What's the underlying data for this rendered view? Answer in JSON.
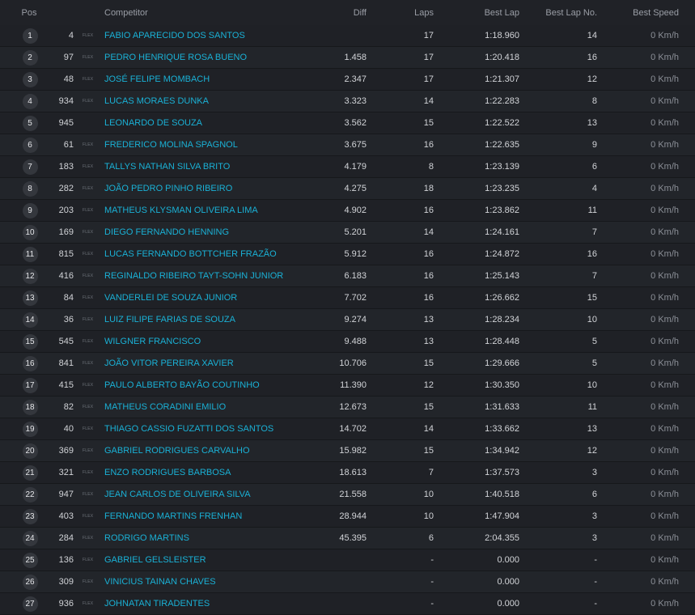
{
  "headers": {
    "pos": "Pos",
    "competitor": "Competitor",
    "diff": "Diff",
    "laps": "Laps",
    "best_lap": "Best Lap",
    "best_lap_no": "Best Lap No.",
    "best_speed": "Best Speed"
  },
  "rows": [
    {
      "pos": "1",
      "number": "4",
      "class": "FLEX",
      "name": "FABIO APARECIDO DOS SANTOS",
      "diff": "",
      "laps": "17",
      "best_lap": "1:18.960",
      "best_lap_no": "14",
      "best_speed": "0 Km/h"
    },
    {
      "pos": "2",
      "number": "97",
      "class": "FLEX",
      "name": "PEDRO HENRIQUE ROSA BUENO",
      "diff": "1.458",
      "laps": "17",
      "best_lap": "1:20.418",
      "best_lap_no": "16",
      "best_speed": "0 Km/h"
    },
    {
      "pos": "3",
      "number": "48",
      "class": "FLEX",
      "name": "JOSÉ FELIPE MOMBACH",
      "diff": "2.347",
      "laps": "17",
      "best_lap": "1:21.307",
      "best_lap_no": "12",
      "best_speed": "0 Km/h"
    },
    {
      "pos": "4",
      "number": "934",
      "class": "FLEX",
      "name": "LUCAS MORAES DUNKA",
      "diff": "3.323",
      "laps": "14",
      "best_lap": "1:22.283",
      "best_lap_no": "8",
      "best_speed": "0 Km/h"
    },
    {
      "pos": "5",
      "number": "945",
      "class": "",
      "name": "LEONARDO DE SOUZA",
      "diff": "3.562",
      "laps": "15",
      "best_lap": "1:22.522",
      "best_lap_no": "13",
      "best_speed": "0 Km/h"
    },
    {
      "pos": "6",
      "number": "61",
      "class": "FLEX",
      "name": "FREDERICO MOLINA SPAGNOL",
      "diff": "3.675",
      "laps": "16",
      "best_lap": "1:22.635",
      "best_lap_no": "9",
      "best_speed": "0 Km/h"
    },
    {
      "pos": "7",
      "number": "183",
      "class": "FLEX",
      "name": "TALLYS NATHAN SILVA BRITO",
      "diff": "4.179",
      "laps": "8",
      "best_lap": "1:23.139",
      "best_lap_no": "6",
      "best_speed": "0 Km/h"
    },
    {
      "pos": "8",
      "number": "282",
      "class": "FLEX",
      "name": "JOÃO PEDRO PINHO RIBEIRO",
      "diff": "4.275",
      "laps": "18",
      "best_lap": "1:23.235",
      "best_lap_no": "4",
      "best_speed": "0 Km/h"
    },
    {
      "pos": "9",
      "number": "203",
      "class": "FLEX",
      "name": "MATHEUS KLYSMAN OLIVEIRA LIMA",
      "diff": "4.902",
      "laps": "16",
      "best_lap": "1:23.862",
      "best_lap_no": "11",
      "best_speed": "0 Km/h"
    },
    {
      "pos": "10",
      "number": "169",
      "class": "FLEX",
      "name": "DIEGO FERNANDO HENNING",
      "diff": "5.201",
      "laps": "14",
      "best_lap": "1:24.161",
      "best_lap_no": "7",
      "best_speed": "0 Km/h"
    },
    {
      "pos": "11",
      "number": "815",
      "class": "FLEX",
      "name": "LUCAS FERNANDO BOTTCHER FRAZÃO",
      "diff": "5.912",
      "laps": "16",
      "best_lap": "1:24.872",
      "best_lap_no": "16",
      "best_speed": "0 Km/h"
    },
    {
      "pos": "12",
      "number": "416",
      "class": "FLEX",
      "name": "REGINALDO RIBEIRO TAYT-SOHN JUNIOR",
      "diff": "6.183",
      "laps": "16",
      "best_lap": "1:25.143",
      "best_lap_no": "7",
      "best_speed": "0 Km/h"
    },
    {
      "pos": "13",
      "number": "84",
      "class": "FLEX",
      "name": "VANDERLEI DE SOUZA JUNIOR",
      "diff": "7.702",
      "laps": "16",
      "best_lap": "1:26.662",
      "best_lap_no": "15",
      "best_speed": "0 Km/h"
    },
    {
      "pos": "14",
      "number": "36",
      "class": "FLEX",
      "name": "LUIZ FILIPE FARIAS DE SOUZA",
      "diff": "9.274",
      "laps": "13",
      "best_lap": "1:28.234",
      "best_lap_no": "10",
      "best_speed": "0 Km/h"
    },
    {
      "pos": "15",
      "number": "545",
      "class": "FLEX",
      "name": "WILGNER FRANCISCO",
      "diff": "9.488",
      "laps": "13",
      "best_lap": "1:28.448",
      "best_lap_no": "5",
      "best_speed": "0 Km/h"
    },
    {
      "pos": "16",
      "number": "841",
      "class": "FLEX",
      "name": "JOÃO VITOR PEREIRA XAVIER",
      "diff": "10.706",
      "laps": "15",
      "best_lap": "1:29.666",
      "best_lap_no": "5",
      "best_speed": "0 Km/h"
    },
    {
      "pos": "17",
      "number": "415",
      "class": "FLEX",
      "name": "PAULO ALBERTO BAYÃO COUTINHO",
      "diff": "11.390",
      "laps": "12",
      "best_lap": "1:30.350",
      "best_lap_no": "10",
      "best_speed": "0 Km/h"
    },
    {
      "pos": "18",
      "number": "82",
      "class": "FLEX",
      "name": "MATHEUS CORADINI EMILIO",
      "diff": "12.673",
      "laps": "15",
      "best_lap": "1:31.633",
      "best_lap_no": "11",
      "best_speed": "0 Km/h"
    },
    {
      "pos": "19",
      "number": "40",
      "class": "FLEX",
      "name": "THIAGO CASSIO FUZATTI DOS SANTOS",
      "diff": "14.702",
      "laps": "14",
      "best_lap": "1:33.662",
      "best_lap_no": "13",
      "best_speed": "0 Km/h"
    },
    {
      "pos": "20",
      "number": "369",
      "class": "FLEX",
      "name": "GABRIEL RODRIGUES CARVALHO",
      "diff": "15.982",
      "laps": "15",
      "best_lap": "1:34.942",
      "best_lap_no": "12",
      "best_speed": "0 Km/h"
    },
    {
      "pos": "21",
      "number": "321",
      "class": "FLEX",
      "name": "ENZO RODRIGUES BARBOSA",
      "diff": "18.613",
      "laps": "7",
      "best_lap": "1:37.573",
      "best_lap_no": "3",
      "best_speed": "0 Km/h"
    },
    {
      "pos": "22",
      "number": "947",
      "class": "FLEX",
      "name": "JEAN CARLOS DE OLIVEIRA SILVA",
      "diff": "21.558",
      "laps": "10",
      "best_lap": "1:40.518",
      "best_lap_no": "6",
      "best_speed": "0 Km/h"
    },
    {
      "pos": "23",
      "number": "403",
      "class": "FLEX",
      "name": "FERNANDO MARTINS FRENHAN",
      "diff": "28.944",
      "laps": "10",
      "best_lap": "1:47.904",
      "best_lap_no": "3",
      "best_speed": "0 Km/h"
    },
    {
      "pos": "24",
      "number": "284",
      "class": "FLEX",
      "name": "RODRIGO MARTINS",
      "diff": "45.395",
      "laps": "6",
      "best_lap": "2:04.355",
      "best_lap_no": "3",
      "best_speed": "0 Km/h"
    },
    {
      "pos": "25",
      "number": "136",
      "class": "FLEX",
      "name": "GABRIEL GELSLEISTER",
      "diff": "",
      "laps": "-",
      "best_lap": "0.000",
      "best_lap_no": "-",
      "best_speed": "0 Km/h"
    },
    {
      "pos": "26",
      "number": "309",
      "class": "FLEX",
      "name": "VINICIUS TAINAN CHAVES",
      "diff": "",
      "laps": "-",
      "best_lap": "0.000",
      "best_lap_no": "-",
      "best_speed": "0 Km/h"
    },
    {
      "pos": "27",
      "number": "936",
      "class": "FLEX",
      "name": "JOHNATAN TIRADENTES",
      "diff": "",
      "laps": "-",
      "best_lap": "0.000",
      "best_lap_no": "-",
      "best_speed": "0 Km/h"
    }
  ]
}
